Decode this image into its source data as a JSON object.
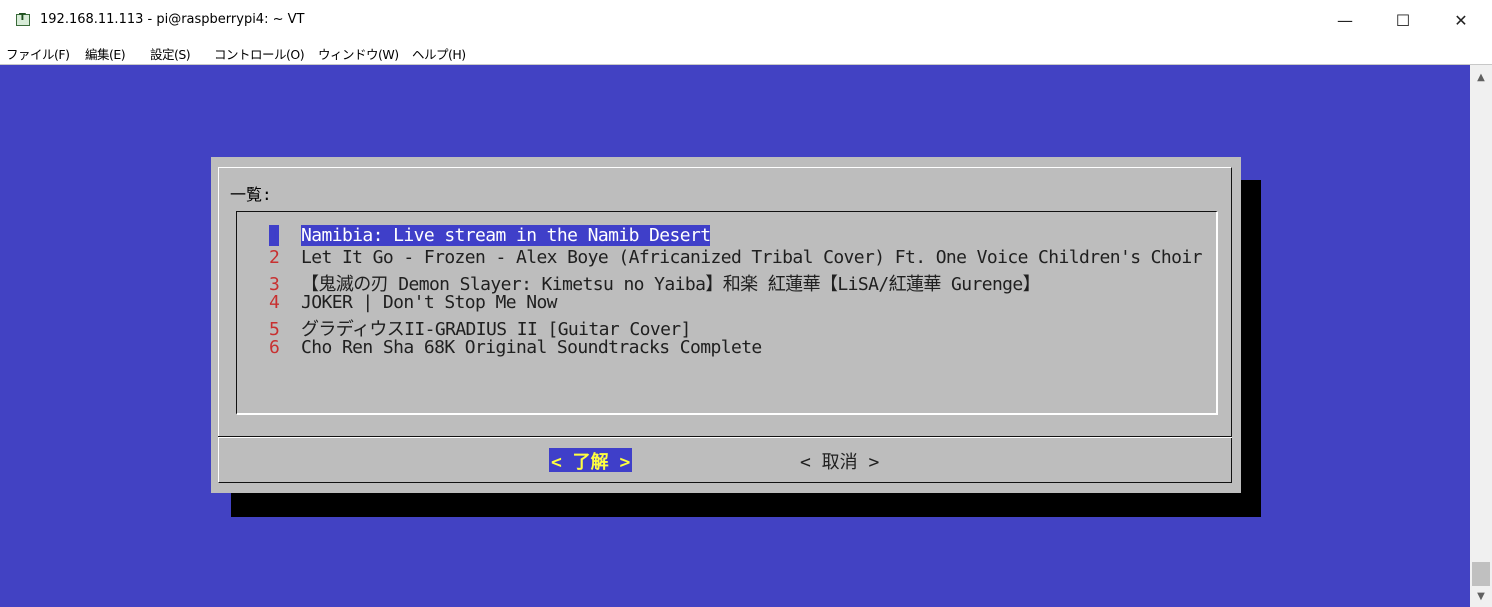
{
  "window": {
    "title": "192.168.11.113 - pi@raspberrypi4: ~ VT",
    "minimize": "—",
    "maximize": "☐",
    "close": "✕"
  },
  "menu": [
    "ファイル(F)",
    "編集(E)",
    "設定(S)",
    "コントロール(O)",
    "ウィンドウ(W)",
    "ヘルプ(H)"
  ],
  "dialog": {
    "label": "一覧:",
    "items": [
      {
        "num": "1",
        "title": "Namibia: Live stream in the Namib Desert",
        "selected": true
      },
      {
        "num": "2",
        "title": "Let It Go - Frozen - Alex Boye (Africanized Tribal Cover) Ft. One Voice Children's Choir"
      },
      {
        "num": "3",
        "title": "【鬼滅の刃 Demon Slayer: Kimetsu no Yaiba】和楽 紅蓮華【LiSA/紅蓮華 Gurenge】"
      },
      {
        "num": "4",
        "title": "JOKER | Don't Stop Me Now"
      },
      {
        "num": "5",
        "title": "グラディウスII-GRADIUS II [Guitar Cover]"
      },
      {
        "num": "6",
        "title": "Cho Ren Sha 68K Original Soundtracks Complete"
      }
    ],
    "ok_button": "< 了解 >",
    "cancel_button": "< 取消 >"
  },
  "colors": {
    "terminal_bg": "#4242c3",
    "dialog_bg": "#bdbdbd",
    "selection_bg": "#3f3fc9",
    "number_color": "#c83030",
    "ok_text": "#ffff40"
  },
  "icons": {
    "app": "teraterm-icon",
    "scroll_up": "scroll-up-arrow-icon",
    "scroll_down": "scroll-down-arrow-icon"
  }
}
